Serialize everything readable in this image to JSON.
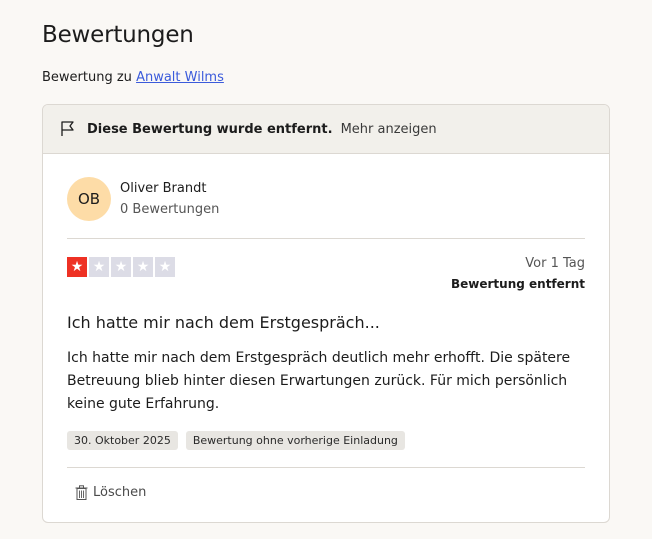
{
  "page": {
    "title": "Bewertungen",
    "subtitle_prefix": "Bewertung zu",
    "business_link": "Anwalt Wilms"
  },
  "notice": {
    "message": "Diese Bewertung wurde entfernt.",
    "more_label": "Mehr anzeigen",
    "icon": "flag-icon"
  },
  "review": {
    "author_initials": "OB",
    "author_name": "Oliver Brandt",
    "author_review_count": "0 Bewertungen",
    "rating": 1,
    "rating_max": 5,
    "relative_date": "Vor 1 Tag",
    "status": "Bewertung entfernt",
    "title": "Ich hatte mir nach dem Erstgespräch...",
    "body": "Ich hatte mir nach dem Erstgespräch deutlich mehr erhofft. Die spätere Betreuung blieb hinter diesen Erwartungen zurück. Für mich persönlich keine gute Erfahrung.",
    "tags": [
      "30. Oktober 2025",
      "Bewertung ohne vorherige Einladung"
    ],
    "delete_label": "Löschen"
  },
  "colors": {
    "star_filled": "#ee3124",
    "star_empty": "#dcdce6",
    "avatar_bg": "#fddca7",
    "link": "#3b5bdb"
  }
}
